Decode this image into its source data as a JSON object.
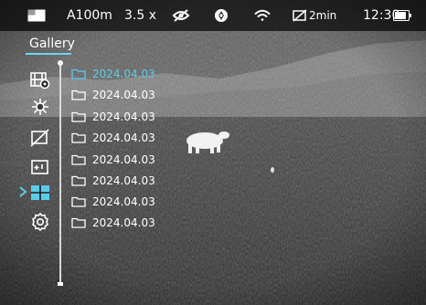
{
  "status_bar": {
    "range": "A100m",
    "zoom": "3.5 x",
    "recording_time": "2min",
    "clock": "12:30",
    "battery_level": 0.85
  },
  "gallery": {
    "title": "Gallery",
    "selected_index": 0,
    "folders": [
      {
        "name": "2024.04.03"
      },
      {
        "name": "2024.04.03"
      },
      {
        "name": "2024.04.03"
      },
      {
        "name": "2024.04.03"
      },
      {
        "name": "2024.04.03"
      },
      {
        "name": "2024.04.03"
      },
      {
        "name": "2024.04.03"
      },
      {
        "name": "2024.04.03"
      }
    ]
  },
  "side_menu": {
    "selected": "gallery-menu-icon",
    "icons": [
      "video-photo-icon",
      "brightness-icon",
      "display-off-icon",
      "zoom-icon",
      "gallery-menu-icon",
      "settings-icon"
    ]
  },
  "colors": {
    "accent": "#5ccbe8",
    "text": "#ffffff",
    "overlay": "#000000"
  }
}
